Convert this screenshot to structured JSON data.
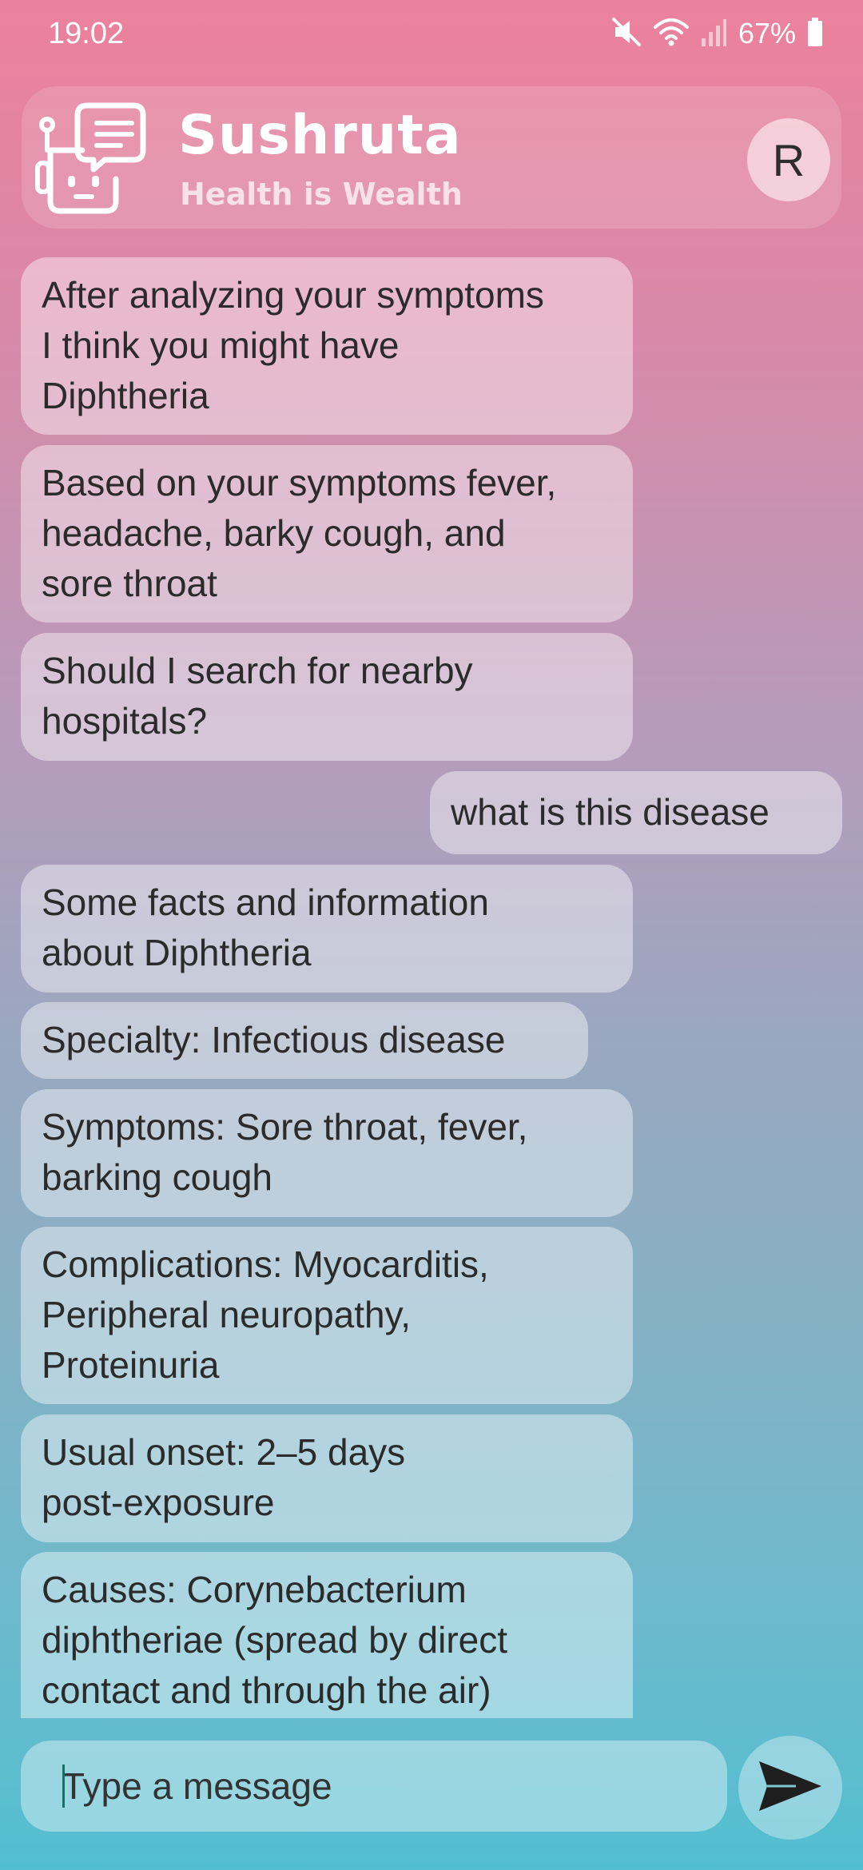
{
  "status_bar": {
    "time": "19:02",
    "battery": "67%",
    "icons": [
      "mute-icon",
      "wifi-icon",
      "signal-icon",
      "battery-icon"
    ]
  },
  "header": {
    "title": "Sushruta",
    "subtitle": "Health is Wealth",
    "logo_icon": "robot-chat-icon",
    "avatar_initial": "R"
  },
  "messages": [
    {
      "sender": "bot",
      "text": "After analyzing your symptoms\nI think you might have\nDiphtheria"
    },
    {
      "sender": "bot",
      "text": "Based on your symptoms fever,\nheadache, barky cough, and\nsore throat"
    },
    {
      "sender": "bot",
      "text": "Should I search for nearby\nhospitals?"
    },
    {
      "sender": "user",
      "text": "what is this disease"
    },
    {
      "sender": "bot",
      "text": "Some facts and information\nabout Diphtheria"
    },
    {
      "sender": "bot",
      "text": "Specialty:  Infectious disease"
    },
    {
      "sender": "bot",
      "text": "Symptoms:  Sore throat, fever,\nbarking cough"
    },
    {
      "sender": "bot",
      "text": "Complications:  Myocarditis,\nPeripheral neuropathy,\nProteinuria"
    },
    {
      "sender": "bot",
      "text": "Usual onset:  2–5 days\npost-exposure"
    },
    {
      "sender": "bot",
      "text": "Causes:   Corynebacterium\ndiphtheriae  (spread by direct\ncontact and through the air)"
    }
  ],
  "composer": {
    "placeholder": "Type a message",
    "value": "",
    "send_icon": "send-icon"
  },
  "colors": {
    "gradient_top": "#ec819d",
    "gradient_bottom": "#52bfd0",
    "bubble": "rgba(255,255,255,0.42)",
    "text": "#2b2b2b"
  }
}
